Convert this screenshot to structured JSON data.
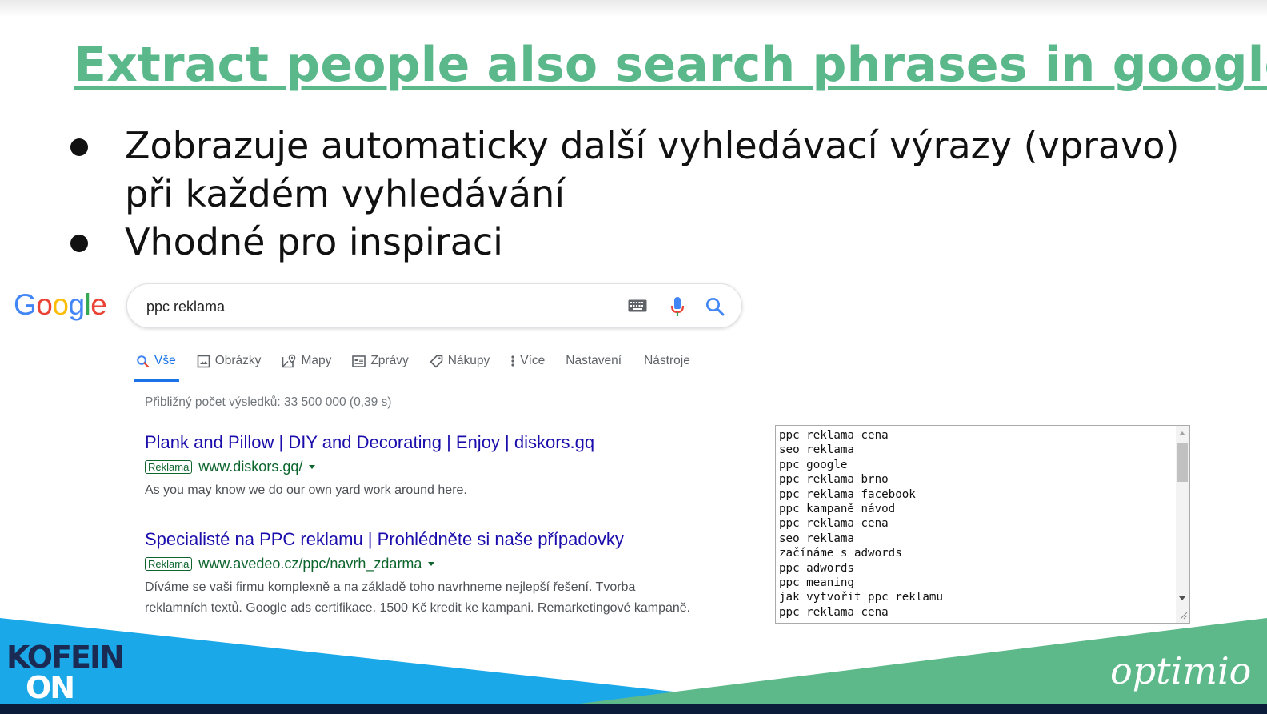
{
  "slide": {
    "title": "Extract people also search phrases in google",
    "bullets": [
      "Zobrazuje automaticky další vyhledávací výrazy (vpravo) při každém vyhledávání",
      "Vhodné pro inspiraci"
    ]
  },
  "google": {
    "logo_letters": [
      "G",
      "o",
      "o",
      "g",
      "l",
      "e"
    ],
    "search_value": "ppc reklama",
    "icons": [
      "keyboard-icon",
      "microphone-icon",
      "search-icon"
    ],
    "tabs": [
      {
        "label": "Vše",
        "icon": "search-icon",
        "active": true
      },
      {
        "label": "Obrázky",
        "icon": "image-icon"
      },
      {
        "label": "Mapy",
        "icon": "map-icon"
      },
      {
        "label": "Zprávy",
        "icon": "news-icon"
      },
      {
        "label": "Nákupy",
        "icon": "tag-icon"
      },
      {
        "label": "Více",
        "icon": "more-vertical-icon"
      },
      {
        "label": "Nastavení"
      },
      {
        "label": "Nástroje"
      }
    ],
    "result_stats": "Přibližný počet výsledků: 33 500 000 (0,39 s)",
    "ads": [
      {
        "title": "Plank and Pillow | DIY and Decorating | Enjoy | diskors.gq",
        "badge": "Reklama",
        "url": "www.diskors.gq/",
        "description": [
          "As you may know we do our own yard work around here."
        ]
      },
      {
        "title": "Specialisté na PPC reklamu | Prohlédněte si naše případovky",
        "badge": "Reklama",
        "url": "www.avedeo.cz/ppc/navrh_zdarma",
        "description": [
          "Díváme se vaši firmu komplexně a na základě toho navrhneme nejlepší řešení. Tvorba",
          "reklamních textů. Google ads certifikace. 1500 Kč kredit ke kampani. Remarketingové kampaně."
        ]
      }
    ]
  },
  "keyword_box": {
    "items": [
      "ppc reklama cena",
      "seo reklama",
      "ppc google",
      "ppc reklama brno",
      "ppc reklama facebook",
      "ppc kampaně návod",
      "ppc reklama cena",
      "seo reklama",
      "začínáme s adwords",
      "ppc adwords",
      "ppc meaning",
      "jak vytvořit ppc reklamu",
      "ppc reklama cena"
    ]
  },
  "footer": {
    "left_logo_lines": [
      "KOFEIN",
      "ON"
    ],
    "right_logo_text": "optimio"
  },
  "colors": {
    "title_green": "#5bb88b",
    "band_blue": "#1ba8e8",
    "band_green": "#5db88a",
    "google_blue": "#1a73e8",
    "ad_link": "#1a0dab",
    "ad_green": "#0d652d",
    "kofein_navy": "#1a2a52"
  }
}
